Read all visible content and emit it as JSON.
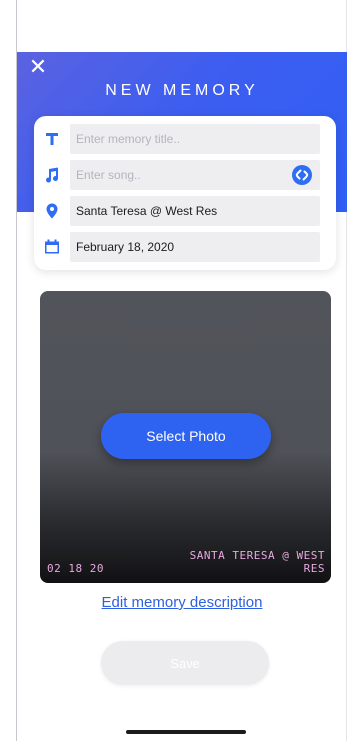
{
  "header": {
    "title": "NEW MEMORY",
    "close_icon": "close-icon",
    "gradient_colors": [
      "#5b62e0",
      "#2f5ff5"
    ]
  },
  "form": {
    "title_field": {
      "icon": "text-icon",
      "placeholder": "Enter memory title..",
      "value": ""
    },
    "song_field": {
      "icon": "music-note-icon",
      "placeholder": "Enter song..",
      "value": "",
      "action_icon": "shazam-icon"
    },
    "location_field": {
      "icon": "location-pin-icon",
      "value": "Santa Teresa @ West Res"
    },
    "date_field": {
      "icon": "calendar-icon",
      "value": "February 18, 2020"
    }
  },
  "photo": {
    "select_label": "Select Photo",
    "stamp_date": "02 18 20",
    "stamp_place": "SANTA TERESA @ WEST RES"
  },
  "edit_description_label": "Edit memory description",
  "save_label": "Save",
  "colors": {
    "accent": "#2d63f0",
    "stamp": "#e7a9e0"
  }
}
